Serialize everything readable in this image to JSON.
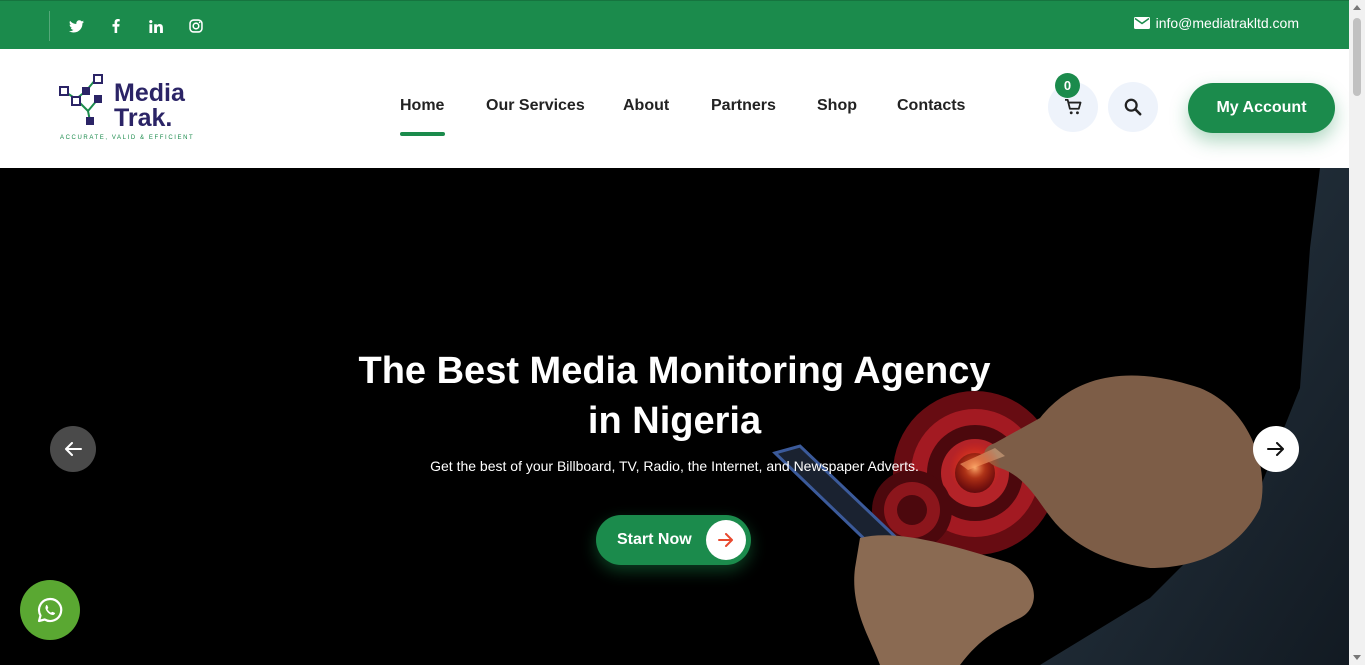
{
  "topbar": {
    "social": [
      {
        "name": "twitter-icon",
        "glyph": "🐦"
      },
      {
        "name": "facebook-icon",
        "glyph": "f"
      },
      {
        "name": "linkedin-icon",
        "glyph": "in"
      },
      {
        "name": "instagram-icon",
        "glyph": "◎"
      }
    ],
    "email": "info@mediatrakltd.com"
  },
  "logo": {
    "line1": "Media",
    "line2": "Trak.",
    "tagline": "ACCURATE, VALID & EFFICIENT"
  },
  "nav": {
    "items": [
      {
        "label": "Home",
        "active": true
      },
      {
        "label": "Our Services"
      },
      {
        "label": "About"
      },
      {
        "label": "Partners"
      },
      {
        "label": "Shop"
      },
      {
        "label": "Contacts"
      }
    ]
  },
  "cart": {
    "count": "0"
  },
  "account": {
    "label": "My Account"
  },
  "hero": {
    "title_line1": "The Best Media Monitoring Agency",
    "title_line2": "in Nigeria",
    "subtitle": "Get the best of your Billboard, TV, Radio, the Internet, and Newspaper Adverts.",
    "cta": "Start Now"
  },
  "colors": {
    "brand_green": "#1b8b4c",
    "logo_navy": "#2b2466",
    "whatsapp_green": "#5aa832"
  }
}
